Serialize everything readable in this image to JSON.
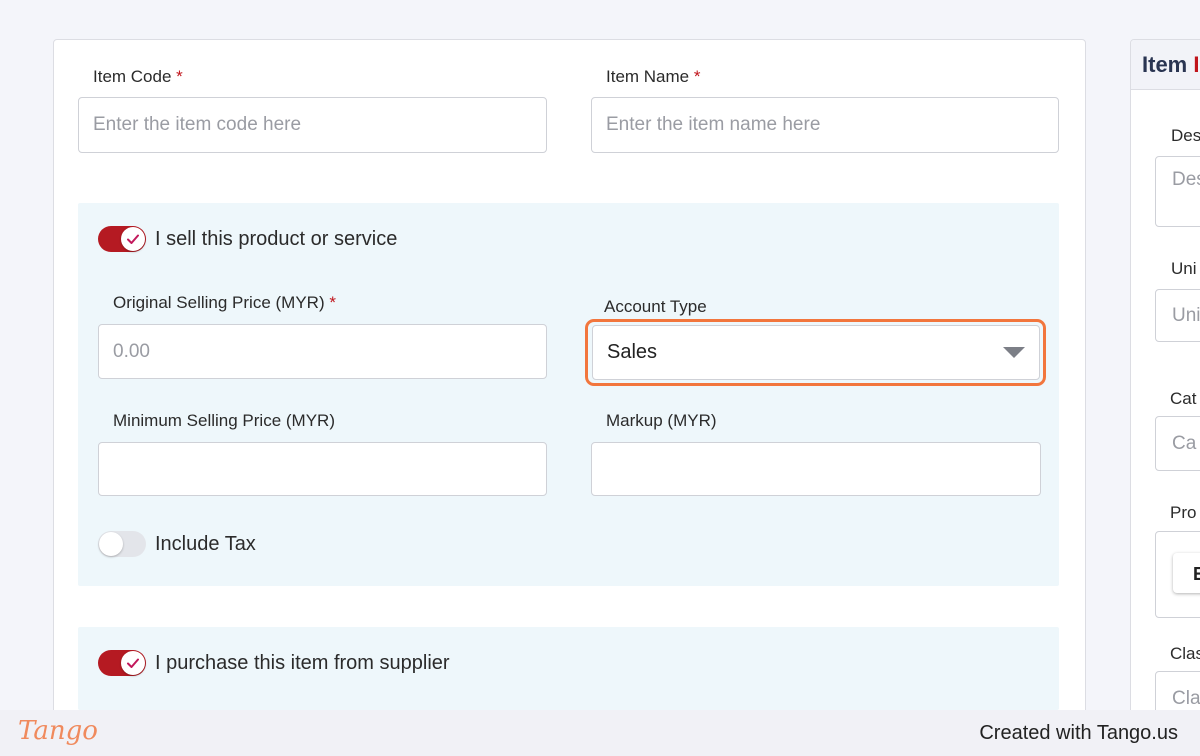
{
  "form": {
    "item_code": {
      "label": "Item Code",
      "required_mark": "*",
      "placeholder": "Enter the item code here"
    },
    "item_name": {
      "label": "Item Name",
      "required_mark": "*",
      "placeholder": "Enter the item name here"
    }
  },
  "sell_section": {
    "toggle_label": "I sell this product or service",
    "toggle_on": true,
    "original_price": {
      "label": "Original Selling Price (MYR)",
      "required_mark": "*",
      "placeholder": "0.00"
    },
    "account_type": {
      "label": "Account Type",
      "value": "Sales"
    },
    "minimum_price": {
      "label": "Minimum Selling Price (MYR)",
      "value": ""
    },
    "markup": {
      "label": "Markup (MYR)",
      "value": ""
    },
    "include_tax": {
      "label": "Include Tax",
      "on": false
    }
  },
  "purchase_section": {
    "toggle_label": "I purchase this item from supplier",
    "toggle_on": true
  },
  "side_panel": {
    "title_visible": "Item",
    "title_cut": "I",
    "fields": [
      {
        "label": "Des",
        "placeholder": "Des"
      },
      {
        "label": "Uni",
        "placeholder": "Uni"
      },
      {
        "label": "Cat",
        "placeholder": "Ca"
      },
      {
        "label": "Pro",
        "button": "E"
      },
      {
        "label": "Clas",
        "placeholder": "Cla"
      }
    ]
  },
  "footer": {
    "logo": "Tango",
    "credit": "Created with Tango.us"
  },
  "colors": {
    "accent_red": "#b51a22",
    "highlight_orange": "#f2763d",
    "section_bg": "#eef7fb"
  }
}
